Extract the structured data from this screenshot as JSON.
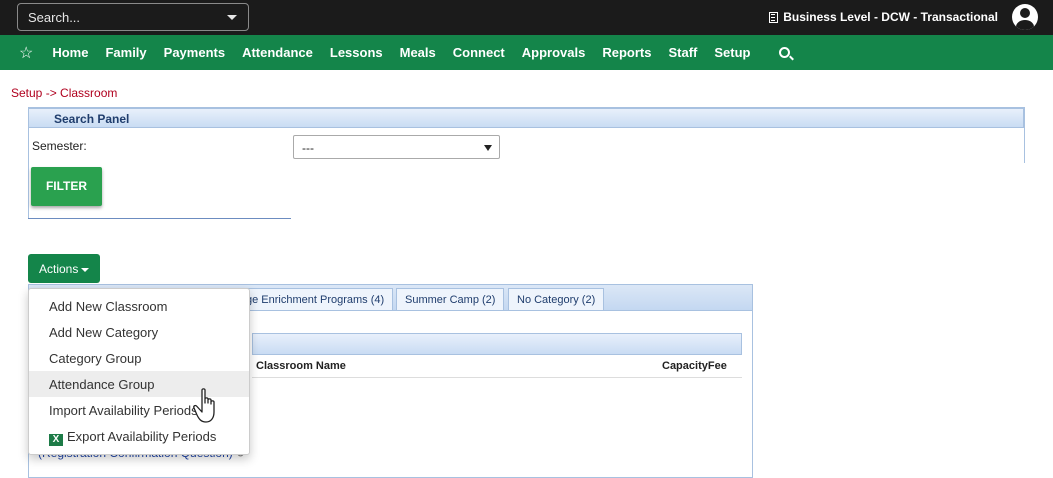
{
  "topbar": {
    "search_placeholder": "Search...",
    "business_label": "Business Level - DCW - Transactional"
  },
  "nav": {
    "items": [
      "Home",
      "Family",
      "Payments",
      "Attendance",
      "Lessons",
      "Meals",
      "Connect",
      "Approvals",
      "Reports",
      "Staff",
      "Setup"
    ]
  },
  "breadcrumb": "Setup -> Classroom",
  "search_panel": {
    "title": "Search Panel",
    "semester_label": "Semester:",
    "semester_value": "---",
    "filter_label": "FILTER"
  },
  "actions": {
    "label": "Actions",
    "menu": [
      {
        "label": "Add New Classroom"
      },
      {
        "label": "Add New Category"
      },
      {
        "label": "Category Group"
      },
      {
        "label": "Attendance Group"
      },
      {
        "label": "Import Availability Periods"
      },
      {
        "label": "Export Availability Periods",
        "icon": "excel-icon"
      }
    ]
  },
  "tabs": [
    {
      "label": "ge Enrichment Programs (4)"
    },
    {
      "label": "Summer Camp (2)"
    },
    {
      "label": "No Category (2)"
    }
  ],
  "table": {
    "col_name": "Classroom Name",
    "col_capacity_fee": "CapacityFee"
  },
  "registration_link": "(Registration Confirmation Question)"
}
